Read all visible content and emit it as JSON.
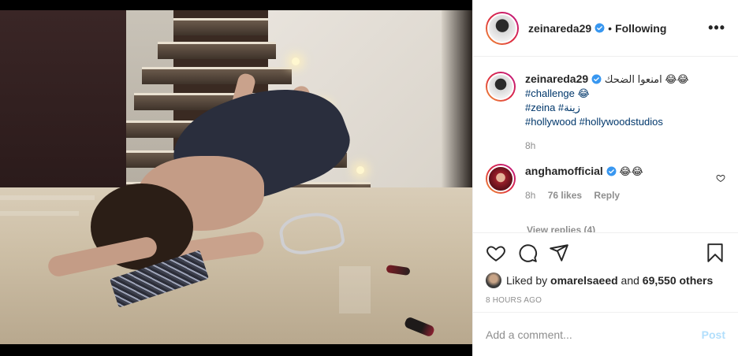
{
  "post": {
    "author": "zeinareda29",
    "follow_status": "Following",
    "separator": "•",
    "more_label": "•••"
  },
  "caption": {
    "username": "zeinareda29",
    "text": "امنعوا الضحك 😂😂",
    "tags": [
      "#challenge 😂",
      "#zeina #زينة",
      "#hollywood #hollywoodstudios"
    ],
    "time": "8h"
  },
  "comments": [
    {
      "username": "anghamofficial",
      "text": "😂😂",
      "time": "8h",
      "likes": "76 likes",
      "reply_label": "Reply"
    }
  ],
  "view_replies": "View replies (4)",
  "likes_line": {
    "prefix": "Liked by",
    "user": "omarelsaeed",
    "middle": "and",
    "others": "69,550 others"
  },
  "timestamp": "8 HOURS AGO",
  "comment_box": {
    "placeholder": "Add a comment...",
    "post_label": "Post"
  },
  "colors": {
    "verified": "#3897f0",
    "link": "#00376b",
    "muted": "#8e8e8e",
    "post_disabled": "#b2dffc"
  },
  "icons": [
    "more-icon",
    "verified-icon",
    "heart-icon",
    "comment-icon",
    "share-icon",
    "bookmark-icon"
  ]
}
